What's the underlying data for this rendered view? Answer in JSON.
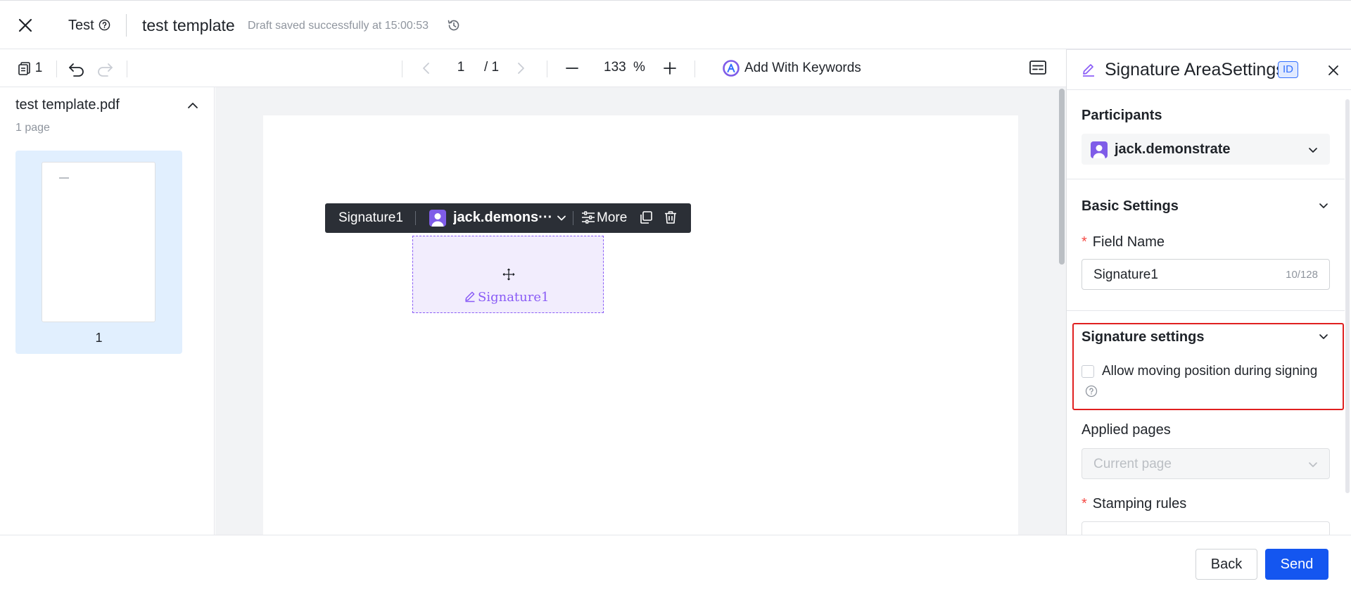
{
  "header": {
    "space_name": "Test",
    "doc_title": "test template",
    "draft_status": "Draft saved successfully at 15:00:53",
    "icons": [
      "close-icon",
      "help-icon",
      "history-icon"
    ]
  },
  "toolbar": {
    "page_count_badge": "1",
    "current_page": "1",
    "total_pages": "/ 1",
    "zoom_value": "133",
    "zoom_unit": "%",
    "add_keywords_label": "Add With Keywords"
  },
  "left_panel": {
    "file_name": "test template.pdf",
    "page_count": "1 page",
    "thumbnails": [
      {
        "page_number": "1"
      }
    ]
  },
  "canvas": {
    "field_toolbar": {
      "field_label": "Signature1",
      "participant": "jack.demons···",
      "more_label": "More"
    },
    "signature_field": {
      "label": "Signature1"
    }
  },
  "right_panel": {
    "title": "Signature AreaSettings",
    "id_badge": "ID",
    "participants": {
      "title": "Participants",
      "selected": "jack.demonstrate"
    },
    "basic_settings": {
      "title": "Basic Settings",
      "field_name_label": "Field Name",
      "required_mark": "*",
      "field_name_value": "Signature1",
      "field_name_count": "10/128"
    },
    "signature_settings": {
      "title": "Signature settings",
      "allow_moving_label": "Allow moving position during signing",
      "allow_moving_checked": false
    },
    "applied_pages": {
      "label": "Applied pages",
      "placeholder": "Current page"
    },
    "stamping_rules": {
      "label": "Stamping rules",
      "required_mark": "*"
    }
  },
  "footer": {
    "back_label": "Back",
    "send_label": "Send"
  },
  "colors": {
    "accent": "#1456f0",
    "signature_purple": "#8a5cf6",
    "highlight_red": "#e02020"
  }
}
